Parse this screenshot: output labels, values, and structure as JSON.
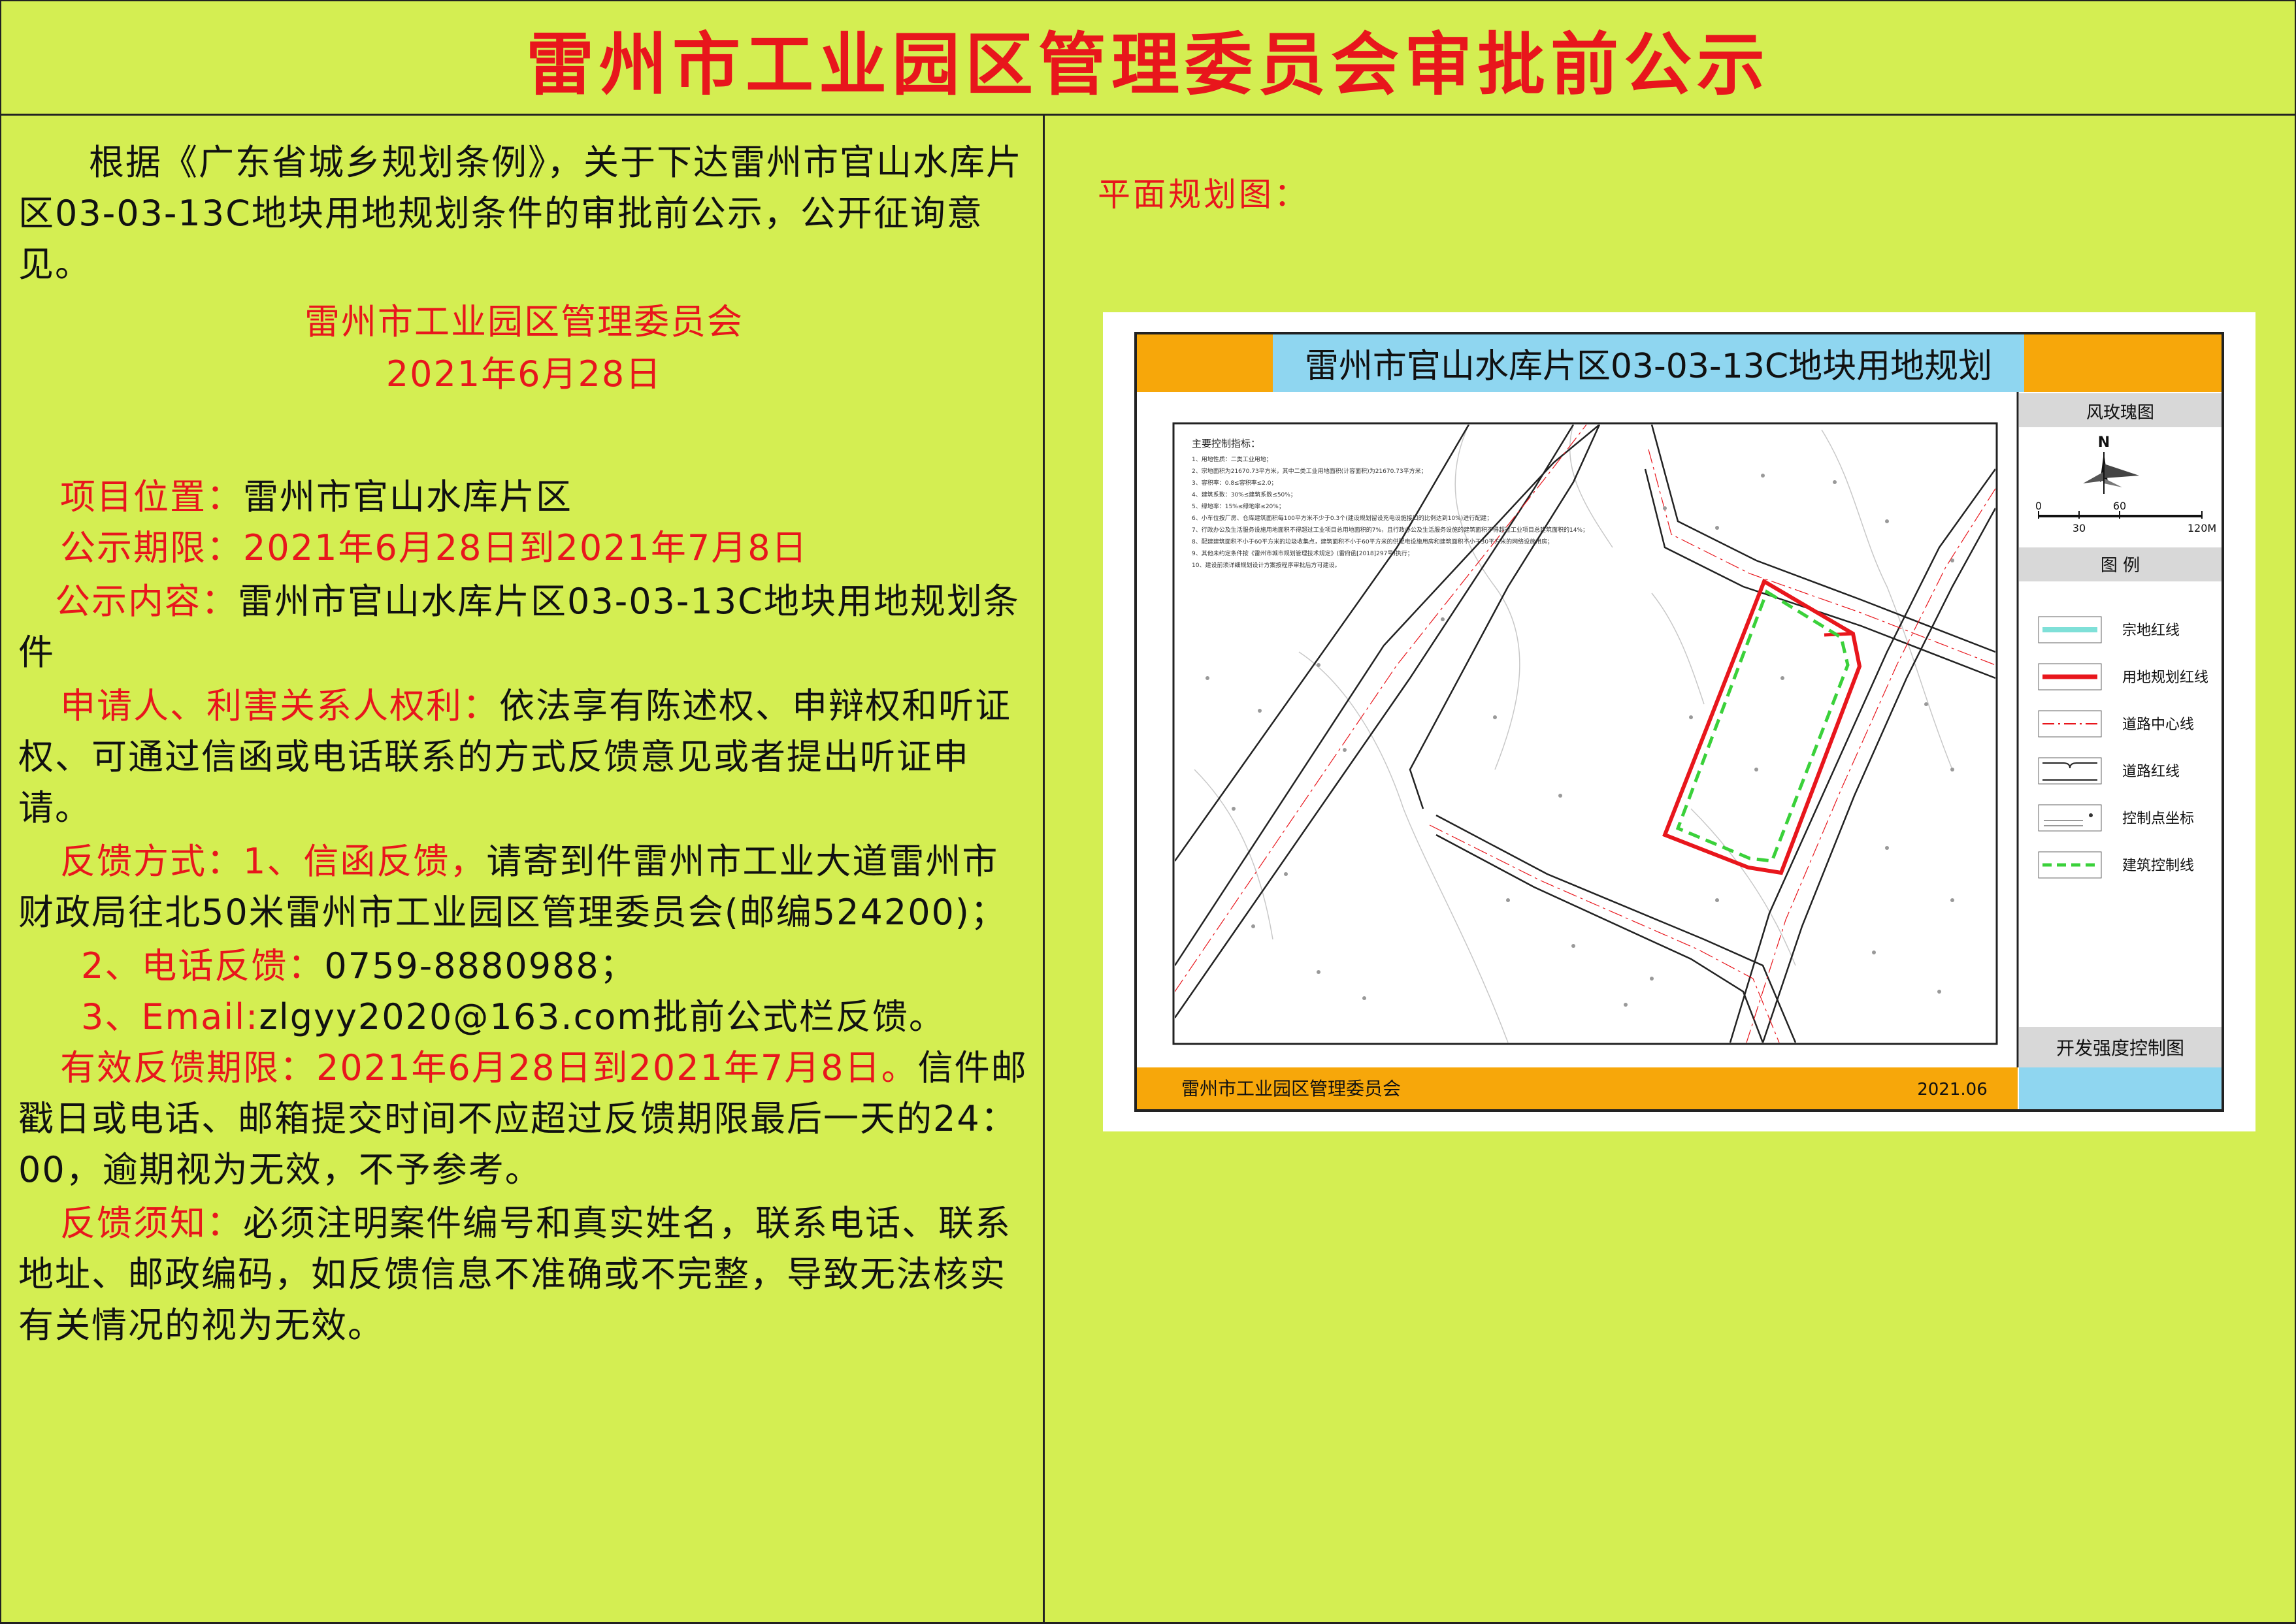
{
  "header": {
    "title": "雷州市工业园区管理委员会审批前公示"
  },
  "notice": {
    "intro": "根据《广东省城乡规划条例》，关于下达雷州市官山水库片区03-03-13C地块用地规划条件的审批前公示，公开征询意见。",
    "issuer": "雷州市工业园区管理委员会",
    "date": "2021年6月28日",
    "location_label": "项目位置：",
    "location_value": "雷州市官山水库片区",
    "period_label": "公示期限：",
    "period_value": "2021年6月28日到2021年7月8日",
    "content_label": "公示内容：",
    "content_value": "雷州市官山水库片区03-03-13C地块用地规划条件",
    "rights_label": "申请人、利害关系人权利：",
    "rights_value": "依法享有陈述权、申辩权和听证权、可通过信函或电话联系的方式反馈意见或者提出听证申请。",
    "feedback_label": "反馈方式：",
    "feedback_1_lead": "1、信函反馈，",
    "feedback_1_value": "请寄到件雷州市工业大道雷州市财政局往北50米雷州市工业园区管理委员会(邮编524200)；",
    "feedback_2_lead": "2、电话反馈：",
    "feedback_2_value": "0759-8880988；",
    "feedback_3_lead": "3、Email:",
    "feedback_3_value": "zlgyy2020@163.com批前公式栏反馈。",
    "deadline_label": "有效反馈期限：",
    "deadline_value_red": "2021年6月28日到2021年7月8日。",
    "deadline_value": "信件邮戳日或电话、邮箱提交时间不应超过反馈期限最后一天的24：00，逾期视为无效，不予参考。",
    "notes_label": "反馈须知：",
    "notes_value": "必须注明案件编号和真实姓名，联系电话、联系地址、邮政编码，如反馈信息不准确或不完整，导致无法核实有关情况的视为无效。"
  },
  "map": {
    "label": "平面规划图：",
    "title": "雷州市官山水库片区03-03-13C地块用地规划",
    "footer_org": "雷州市工业园区管理委员会",
    "footer_date": "2021.06",
    "compass_title": "风玫瑰图",
    "north": "N",
    "scale_0": "0",
    "scale_30": "30",
    "scale_60": "60",
    "scale_120": "120M",
    "legend_title": "图 例",
    "legend": [
      {
        "label": "宗地红线",
        "color": "#7fe0d8"
      },
      {
        "label": "用地规划红线",
        "color": "#e8161c"
      },
      {
        "label": "道路中心线",
        "color": "#e8161c"
      },
      {
        "label": "道路红线",
        "color": "#222222"
      },
      {
        "label": "控制点坐标",
        "color": "#333333"
      },
      {
        "label": "建筑控制线",
        "color": "#3ad13a"
      }
    ],
    "panel_caption": "开发强度控制图",
    "indicators_title": "主要控制指标：",
    "indicators": [
      "1、用地性质：二类工业用地；",
      "2、宗地面积为21670.73平方米，其中二类工业用地面积(计容面积)为21670.73平方米；",
      "3、容积率：0.8≤容积率≤2.0；",
      "4、建筑系数：30%≤建筑系数≤50%；",
      "5、绿地率：15%≤绿地率≤20%；",
      "6、小车位按厂房、仓库建筑面积每100平方米不少于0.3个(建设规划留设充电设施接口的比例达到10%)进行配建；",
      "7、行政办公及生活服务设施用地面积不得超过工业项目总用地面积的7%，且行政办公及生活服务设施的建筑面积不得超过工业项目总建筑面积的14%；",
      "8、配建建筑面积不小于60平方米的垃圾收集点，建筑面积不小于60平方米的供配电设施用房和建筑面积不小于30平方米的网络设施用房；",
      "9、其他未约定条件按《雷州市城市规划管理技术规定》(雷府函[2018]297号)执行；",
      "10、建设前须详细规划设计方案按程序审批后方可建设。"
    ]
  }
}
